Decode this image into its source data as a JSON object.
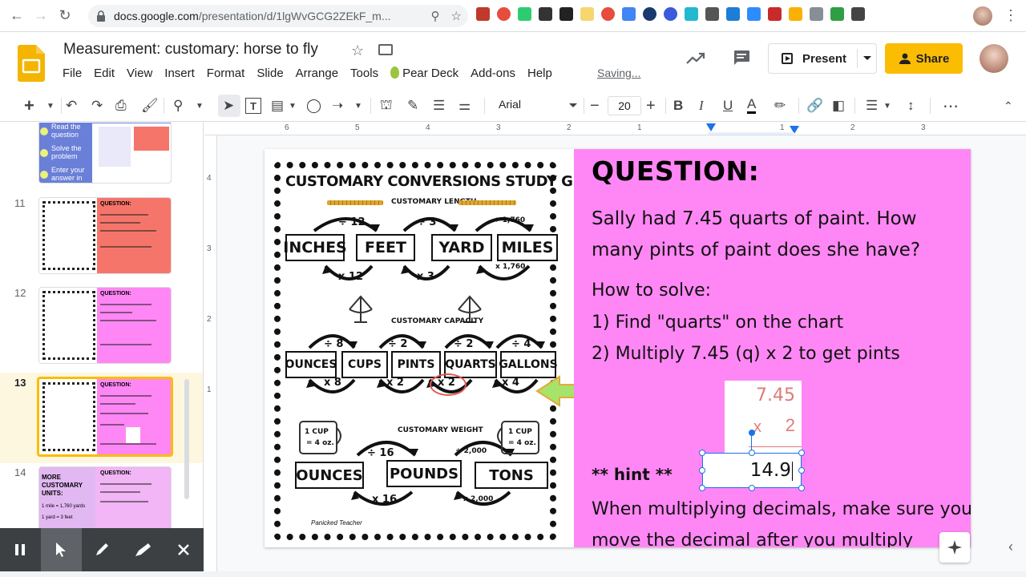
{
  "browser": {
    "url_host": "docs.google.com",
    "url_path": "/presentation/d/1lgWvGCG2ZEkF_m..."
  },
  "doc": {
    "title": "Measurement: customary: horse to fly",
    "saving_status": "Saving..."
  },
  "menu": [
    "File",
    "Edit",
    "View",
    "Insert",
    "Format",
    "Slide",
    "Arrange",
    "Tools",
    "Pear Deck",
    "Add-ons",
    "Help"
  ],
  "header": {
    "present_label": "Present",
    "share_label": "Share"
  },
  "toolbar": {
    "font_name": "Arial",
    "font_size": "20"
  },
  "rulers": {
    "top": [
      "6",
      "5",
      "4",
      "3",
      "2",
      "1",
      "1",
      "2",
      "3"
    ],
    "left": [
      "4",
      "3",
      "2",
      "1"
    ]
  },
  "slides_panel": {
    "thumb10": {
      "lines": [
        "Read the question",
        "Solve the problem",
        "Enter your answer in the box"
      ]
    },
    "items": [
      {
        "number": "11",
        "title": "QUESTION:"
      },
      {
        "number": "12",
        "title": "QUESTION:"
      },
      {
        "number": "13",
        "title": "QUESTION:"
      },
      {
        "number": "14",
        "title": "QUESTION:"
      }
    ],
    "thumb14_left": [
      "MORE",
      "CUSTOMARY",
      "UNITS:",
      "1 mile = 1,760 yards",
      "1 yard = 3 feet"
    ]
  },
  "slide": {
    "guide": {
      "title": "CUSTOMARY CONVERSIONS STUDY GUIDE",
      "length_label": "CUSTOMARY LENGTH",
      "capacity_label": "CUSTOMARY CAPACITY",
      "weight_label": "CUSTOMARY WEIGHT",
      "length_units": [
        "INCHES",
        "FEET",
        "YARD",
        "MILES"
      ],
      "length_div": [
        "÷ 12",
        "÷ 3",
        "÷ 1,760"
      ],
      "length_mul": [
        "x 12",
        "x 3",
        "x 1,760"
      ],
      "capacity_units": [
        "OUNCES",
        "CUPS",
        "PINTS",
        "QUARTS",
        "GALLONS"
      ],
      "capacity_div": [
        "÷ 8",
        "÷ 2",
        "÷ 2",
        "÷ 4"
      ],
      "capacity_mul": [
        "x 8",
        "x 2",
        "x 2",
        "x 4"
      ],
      "weight_units": [
        "OUNCES",
        "POUNDS",
        "TONS"
      ],
      "weight_div": [
        "÷ 16",
        "÷ 2,000"
      ],
      "weight_mul": [
        "x 16",
        "x 2,000"
      ],
      "cup_label": "1 CUP",
      "oz_label": "= 4 oz.",
      "author": "Panicked Teacher"
    },
    "question": {
      "title": "QUESTION:",
      "body": "Sally had 7.45 quarts of paint.  How many pints of paint does she have?",
      "how_title": "How to solve:",
      "step1": "1)  Find \"quarts\" on the chart",
      "step2": "2) Multiply 7.45 (q) x 2 to get pints",
      "mult_top": "7.45",
      "mult_x": "x",
      "mult_bottom": "2",
      "hint": "** hint **",
      "answer": "14.9",
      "hint_text": "When multiplying decimals, make sure you move the decimal after you multiply"
    }
  },
  "colors": {
    "question_bg": "#ff87f5",
    "share_bg": "#fbbc04",
    "selection_blue": "#1a73e8",
    "thumb_red": "#f6756b"
  }
}
